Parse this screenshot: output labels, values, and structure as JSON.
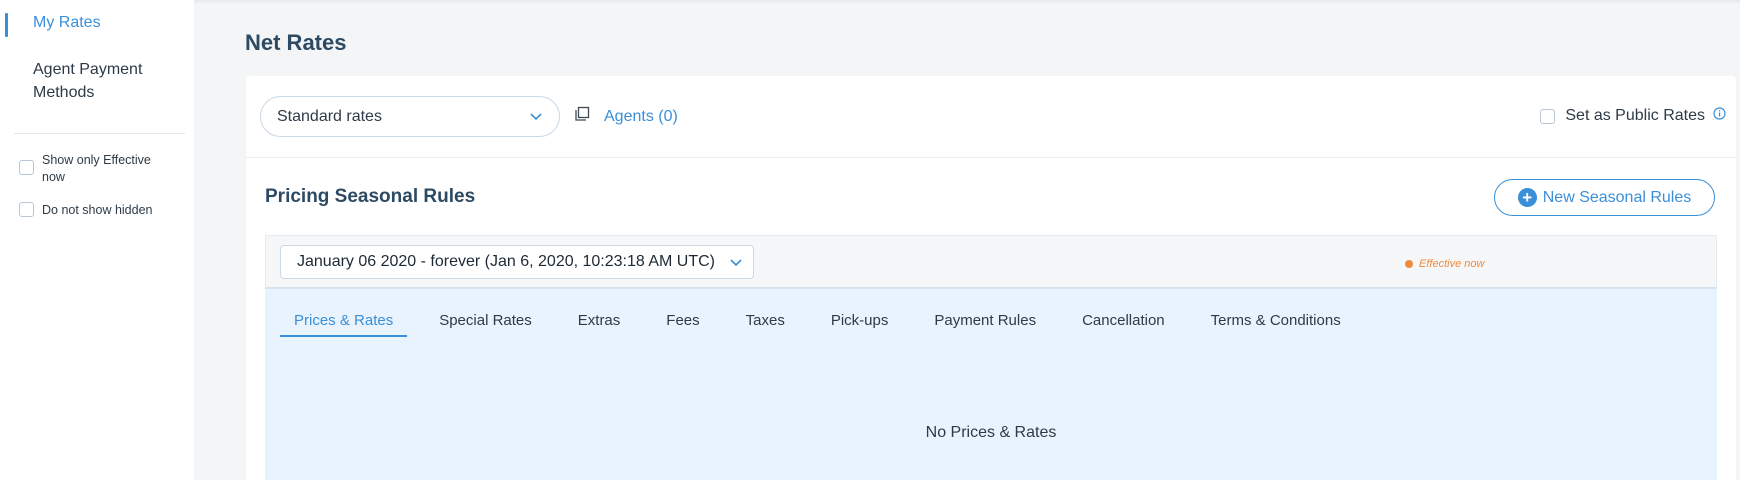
{
  "sidebar": {
    "items": [
      {
        "label": "My Rates",
        "active": true
      },
      {
        "label": "Agent Payment Methods",
        "active": false
      }
    ],
    "filters": [
      {
        "label": "Show only Effective now",
        "checked": false
      },
      {
        "label": "Do not show hidden",
        "checked": false
      }
    ]
  },
  "page": {
    "title": "Net Rates"
  },
  "toolbar": {
    "rate_type_selected": "Standard rates",
    "agents_label": "Agents (0)",
    "public_rates_label": "Set as Public Rates",
    "public_rates_checked": false
  },
  "seasonal": {
    "title": "Pricing Seasonal Rules",
    "new_button_label": "New Seasonal Rules",
    "period_selected": "January 06 2020 - forever (Jan 6, 2020, 10:23:18 AM UTC)",
    "status": "Effective now",
    "tabs": [
      {
        "label": "Prices & Rates",
        "active": true
      },
      {
        "label": "Special Rates",
        "active": false
      },
      {
        "label": "Extras",
        "active": false
      },
      {
        "label": "Fees",
        "active": false
      },
      {
        "label": "Taxes",
        "active": false
      },
      {
        "label": "Pick-ups",
        "active": false
      },
      {
        "label": "Payment Rules",
        "active": false
      },
      {
        "label": "Cancellation",
        "active": false
      },
      {
        "label": "Terms & Conditions",
        "active": false
      }
    ],
    "empty_message": "No Prices & Rates"
  },
  "colors": {
    "accent": "#3a8fd9",
    "status": "#f08a3c",
    "panel": "#e8f3fd"
  },
  "icons": [
    "chevron-down-icon",
    "copy-icon",
    "info-icon",
    "plus-circle-icon",
    "status-dot-icon"
  ]
}
